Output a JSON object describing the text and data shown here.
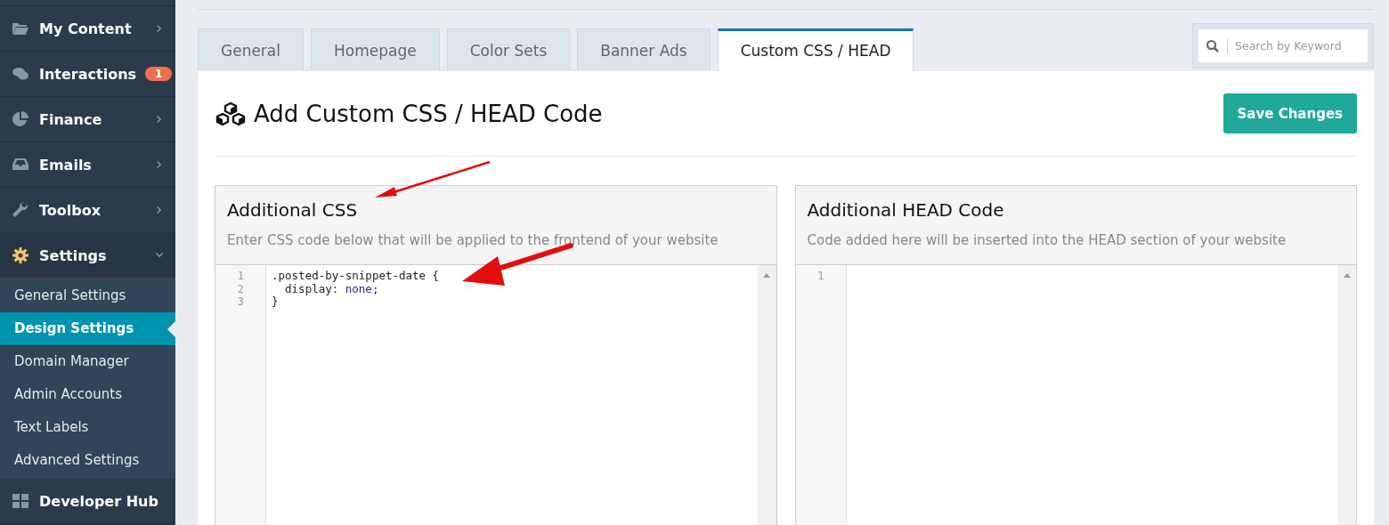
{
  "sidebar": {
    "items": [
      {
        "label": "My Content",
        "kind": "folder",
        "expanded": false
      },
      {
        "label": "Interactions",
        "kind": "chat",
        "badge": "1"
      },
      {
        "label": "Finance",
        "kind": "pie",
        "expanded": false
      },
      {
        "label": "Emails",
        "kind": "inbox",
        "expanded": false
      },
      {
        "label": "Toolbox",
        "kind": "wrench",
        "expanded": false
      },
      {
        "label": "Settings",
        "kind": "gear",
        "expanded": true,
        "children": [
          {
            "label": "General Settings",
            "selected": false
          },
          {
            "label": "Design Settings",
            "selected": true
          },
          {
            "label": "Domain Manager",
            "selected": false
          },
          {
            "label": "Admin Accounts",
            "selected": false
          },
          {
            "label": "Text Labels",
            "selected": false
          },
          {
            "label": "Advanced Settings",
            "selected": false
          }
        ]
      },
      {
        "label": "Developer Hub",
        "kind": "grid"
      }
    ]
  },
  "tabs": [
    {
      "label": "General",
      "selected": false
    },
    {
      "label": "Homepage",
      "selected": false
    },
    {
      "label": "Color Sets",
      "selected": false
    },
    {
      "label": "Banner Ads",
      "selected": false
    },
    {
      "label": "Custom CSS / HEAD",
      "selected": true
    }
  ],
  "search": {
    "placeholder": "Search by Keyword"
  },
  "page_title": "Add Custom CSS / HEAD Code",
  "save_button": "Save Changes",
  "panels": [
    {
      "title": "Additional CSS",
      "description": "Enter CSS code below that will be applied to the frontend of your website",
      "lines": [
        {
          "number": "1",
          "tokens": [
            {
              "text": ".posted-by-snippet-date {",
              "kind": "plain"
            }
          ]
        },
        {
          "number": "2",
          "tokens": [
            {
              "text": "  display: ",
              "kind": "plain"
            },
            {
              "text": "none",
              "kind": "keyword"
            },
            {
              "text": ";",
              "kind": "plain"
            }
          ]
        },
        {
          "number": "3",
          "tokens": [
            {
              "text": "}",
              "kind": "plain"
            }
          ]
        }
      ]
    },
    {
      "title": "Additional HEAD Code",
      "description": "Code added here will be inserted into the HEAD section of your website",
      "lines": [
        {
          "number": "1"
        }
      ]
    }
  ]
}
